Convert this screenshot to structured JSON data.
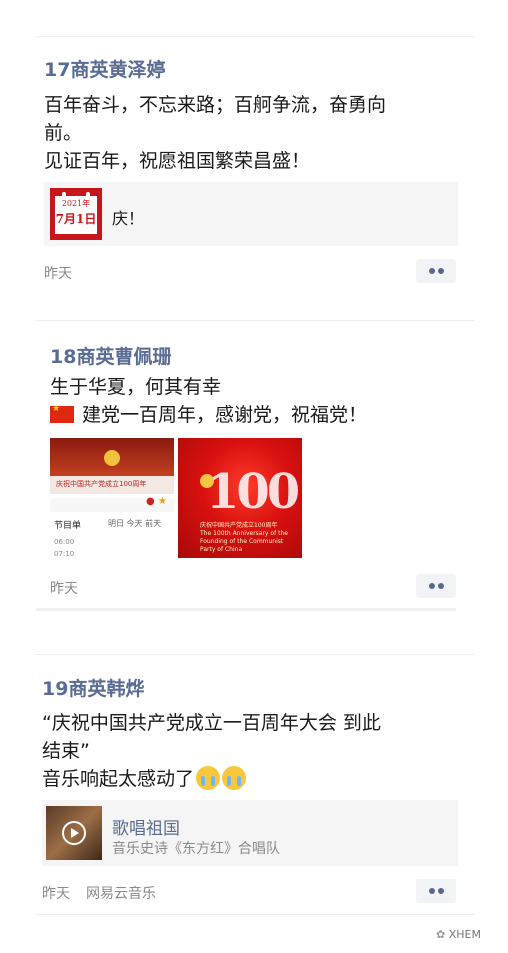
{
  "posts": [
    {
      "author": "17商英黄泽婷",
      "lines": [
        "百年奋斗，不忘来路；百舸争流，奋勇向",
        "前。",
        "见证百年，祝愿祖国繁荣昌盛！"
      ],
      "share": {
        "icon": "calendar-icon",
        "calendar_year": "2021年",
        "calendar_day": "7月1日",
        "text": "庆！"
      },
      "time": "昨天"
    },
    {
      "author": "18商英曹佩珊",
      "lines": [
        "生于华夏，何其有幸",
        "建党一百周年，感谢党，祝福党！"
      ],
      "images": [
        {
          "bar_text": "庆祝中国共产党成立100周年",
          "schedule_title": "节目单",
          "tabs": "明日   今天   前天",
          "rows": [
            "06:00",
            "07:10"
          ]
        },
        {
          "big_text": "100",
          "caption": "庆祝中国共产党成立100周年 The 100th Anniversary of the Founding of the Communist Party of China"
        }
      ],
      "time": "昨天"
    },
    {
      "author": "19商英韩烨",
      "lines": [
        "“庆祝中国共产党成立一百周年大会 到此",
        "结束”",
        "音乐响起太感动了"
      ],
      "music": {
        "title": "歌唱祖国",
        "subtitle": "音乐史诗《东方红》合唱队"
      },
      "time": "昨天",
      "source": "网易云音乐"
    }
  ],
  "watermark": "XHEM",
  "colors": {
    "author_blue": "#5a6c93",
    "card_bg": "#f5f5f5",
    "time_gray": "#8a8a8a",
    "party_red": "#c8161d"
  }
}
